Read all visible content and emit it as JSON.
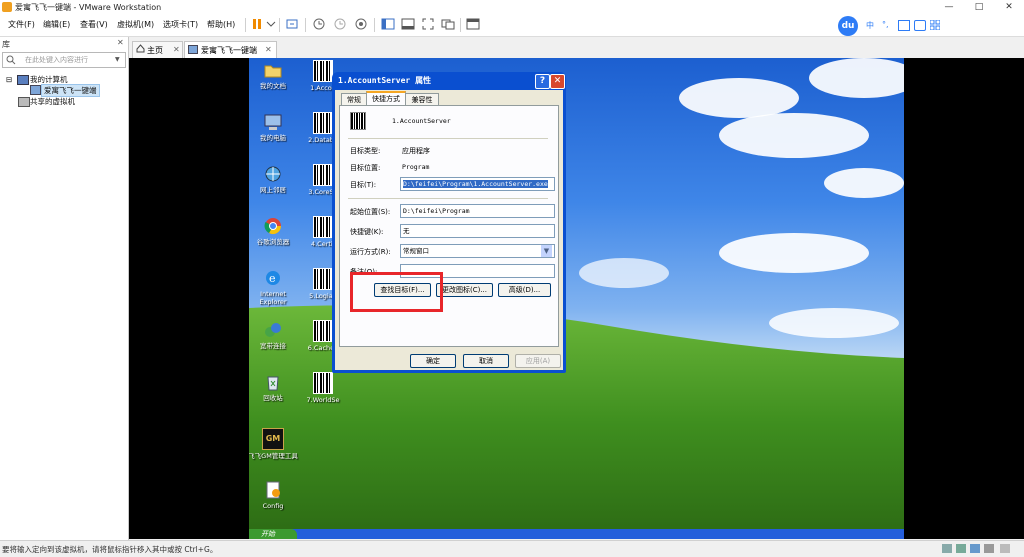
{
  "window": {
    "title": "爱寓飞飞一键端 - VMware Workstation",
    "controls": {
      "minimize": "—",
      "maximize": "□",
      "close": "✕"
    }
  },
  "menu": [
    "文件(F)",
    "编辑(E)",
    "查看(V)",
    "虚拟机(M)",
    "选项卡(T)",
    "帮助(H)"
  ],
  "toolbar_icons": [
    "pause-icon",
    "dropdown-icon",
    "send-keys-icon",
    "snapshot-icon",
    "revert-snapshot-icon",
    "snapshot-manager-icon",
    "library-view-icon",
    "thumbnail-bar-icon",
    "fullscreen-icon",
    "unity-icon",
    "console-view-icon"
  ],
  "baidu": {
    "logo": "du",
    "items": [
      "中",
      "°,"
    ]
  },
  "library": {
    "title": "库",
    "close": "✕",
    "search_placeholder": "在此处键入内容进行",
    "tree": {
      "root": "我的计算机",
      "child": "爱寓飞飞一键端",
      "shared": "共享的虚拟机"
    }
  },
  "tabs": [
    {
      "label": "主页",
      "close": "✕"
    },
    {
      "label": "爱寓飞飞一键端",
      "close": "✕"
    }
  ],
  "desktop": {
    "left_icons": [
      "我的文档",
      "我的电脑",
      "网上邻居",
      "谷歌浏览器",
      "Internet Explorer",
      "宽带连接",
      "回收站",
      "飞飞GM管理工具",
      "Config"
    ],
    "right_icons": [
      "1.Accou",
      "2.Databa",
      "3.CoreSe",
      "4.Certif",
      "5.LogiaS",
      "6.CacheS",
      "7.WorldSe"
    ],
    "gm_logo": "GM",
    "taskbar_start": "开始"
  },
  "dialog": {
    "title": "1.AccountServer 属性",
    "title_buttons": [
      "?",
      "✕"
    ],
    "tabs": [
      "常规",
      "快捷方式",
      "兼容性"
    ],
    "app_name": "1.AccountServer",
    "fields": {
      "target_type": {
        "label": "目标类型:",
        "value": "应用程序"
      },
      "target_location": {
        "label": "目标位置:",
        "value": "Program"
      },
      "target": {
        "label": "目标(T):",
        "value": "D:\\feifei\\Program\\1.AccountServer.exe"
      },
      "start_in": {
        "label": "起始位置(S):",
        "value": "D:\\feifei\\Program"
      },
      "shortcut_key": {
        "label": "快捷键(K):",
        "value": "无"
      },
      "run": {
        "label": "运行方式(R):",
        "value": "常规窗口"
      },
      "comment": {
        "label": "备注(O):",
        "value": ""
      }
    },
    "buttons": {
      "find_target": "查找目标(F)...",
      "change_icon": "更改图标(C)...",
      "advanced": "高级(D)..."
    },
    "footer": {
      "ok": "确定",
      "cancel": "取消",
      "apply": "应用(A)"
    }
  },
  "status": "要将输入定向到该虚拟机，请将鼠标指针移入其中或按 Ctrl+G。",
  "colors": {
    "highlight_box": "#e8262a",
    "xp_blue": "#0a4fd0",
    "selection": "#316ac5"
  }
}
